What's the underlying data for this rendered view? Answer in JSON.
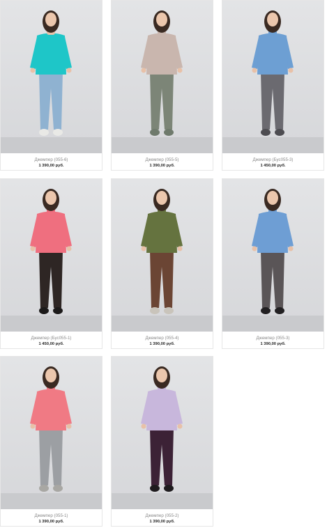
{
  "products": [
    {
      "name": "Джемпер (055-6)",
      "price": "1 390,00 руб.",
      "top_color": "#1ec6c8",
      "bottom_color": "#8fb2d1",
      "shoe_color": "#e9e9e6",
      "turtleneck": false
    },
    {
      "name": "Джемпер (055-5)",
      "price": "1 390,00 руб.",
      "top_color": "#c9b6ae",
      "bottom_color": "#7c8577",
      "shoe_color": "#6f7a6c",
      "turtleneck": true
    },
    {
      "name": "Джемпер (Бус055-3)",
      "price": "1 450,00 руб.",
      "top_color": "#6d9fd3",
      "bottom_color": "#6b6a70",
      "shoe_color": "#4d4c51",
      "turtleneck": true
    },
    {
      "name": "Джемпер (Бус055-1)",
      "price": "1 450,00 руб.",
      "top_color": "#ef6f7f",
      "bottom_color": "#2e2624",
      "shoe_color": "#1c1a1a",
      "turtleneck": true
    },
    {
      "name": "Джемпер (055-4)",
      "price": "1 390,00 руб.",
      "top_color": "#65733f",
      "bottom_color": "#6b4534",
      "shoe_color": "#c9c4bb",
      "turtleneck": true
    },
    {
      "name": "Джемпер (055-3)",
      "price": "1 390,00 руб.",
      "top_color": "#6e9ed4",
      "bottom_color": "#5a5557",
      "shoe_color": "#222022",
      "turtleneck": true
    },
    {
      "name": "Джемпер (055-1)",
      "price": "1 390,00 руб.",
      "top_color": "#f07a84",
      "bottom_color": "#9c9fa3",
      "shoe_color": "#a8a7a3",
      "turtleneck": true
    },
    {
      "name": "Джемпер (055-2)",
      "price": "1 390,00 руб.",
      "top_color": "#c8b7dc",
      "bottom_color": "#3c2236",
      "shoe_color": "#1e1b1e",
      "turtleneck": true
    }
  ]
}
